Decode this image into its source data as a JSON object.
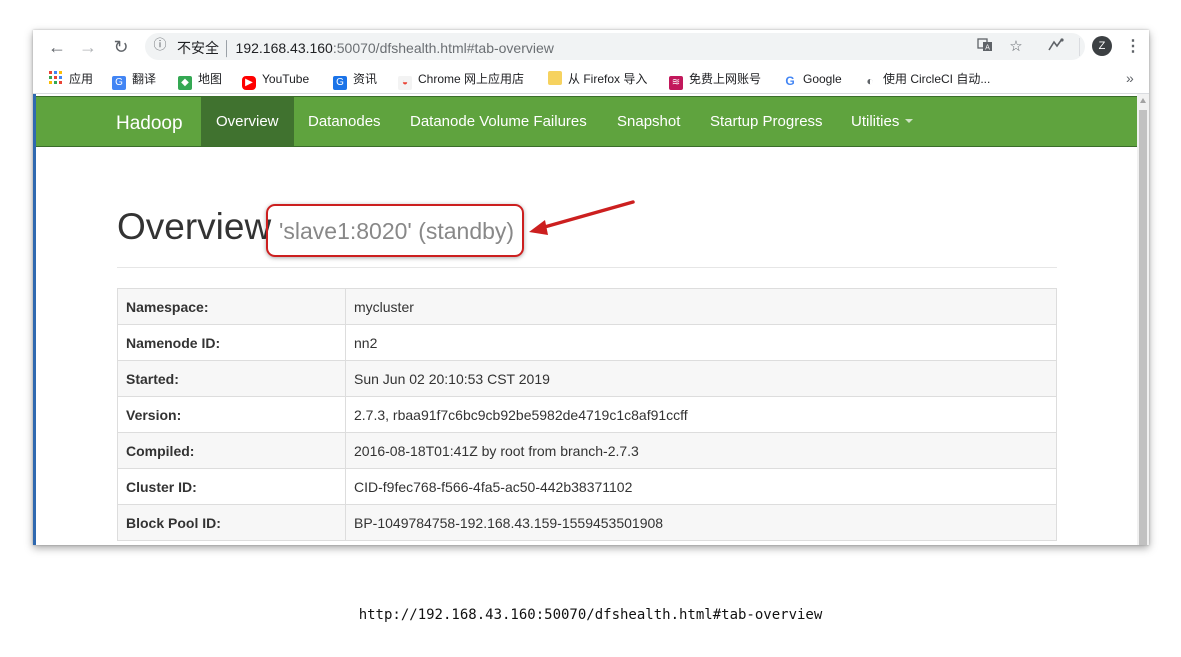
{
  "browser": {
    "security_label": "不安全",
    "url_host": "192.168.43.160",
    "url_rest": ":50070/dfshealth.html#tab-overview",
    "avatar_letter": "Z",
    "bookmarks": [
      {
        "label": "应用",
        "icon": "apps-grid-icon"
      },
      {
        "label": "翻译",
        "icon": "translate-icon"
      },
      {
        "label": "地图",
        "icon": "maps-icon"
      },
      {
        "label": "YouTube",
        "icon": "youtube-icon"
      },
      {
        "label": "资讯",
        "icon": "news-icon"
      },
      {
        "label": "Chrome 网上应用店",
        "icon": "chrome-webstore-icon"
      },
      {
        "label": "从 Firefox 导入",
        "icon": "folder-icon"
      },
      {
        "label": "免费上网账号",
        "icon": "bookmark-icon"
      },
      {
        "label": "Google",
        "icon": "google-icon"
      },
      {
        "label": "使用 CircleCI 自动...",
        "icon": "circleci-icon"
      }
    ],
    "more_bookmarks": "»"
  },
  "hadoop_nav": {
    "brand": "Hadoop",
    "items": [
      {
        "label": "Overview",
        "active": true
      },
      {
        "label": "Datanodes"
      },
      {
        "label": "Datanode Volume Failures"
      },
      {
        "label": "Snapshot"
      },
      {
        "label": "Startup Progress"
      },
      {
        "label": "Utilities"
      }
    ]
  },
  "overview": {
    "title": "Overview",
    "subtitle": "'slave1:8020' (standby)"
  },
  "info_table": [
    {
      "key": "Namespace:",
      "value": "mycluster"
    },
    {
      "key": "Namenode ID:",
      "value": "nn2"
    },
    {
      "key": "Started:",
      "value": "Sun Jun 02 20:10:53 CST 2019"
    },
    {
      "key": "Version:",
      "value": "2.7.3, rbaa91f7c6bc9cb92be5982de4719c1c8af91ccff"
    },
    {
      "key": "Compiled:",
      "value": "2016-08-18T01:41Z by root from branch-2.7.3"
    },
    {
      "key": "Cluster ID:",
      "value": "CID-f9fec768-f566-4fa5-ac50-442b38371102"
    },
    {
      "key": "Block Pool ID:",
      "value": "BP-1049784758-192.168.43.159-1559453501908"
    }
  ],
  "caption": "http://192.168.43.160:50070/dfshealth.html#tab-overview",
  "colors": {
    "nav_green": "#5fa33e",
    "nav_active": "#40722f",
    "highlight_red": "#cc1f1f"
  }
}
